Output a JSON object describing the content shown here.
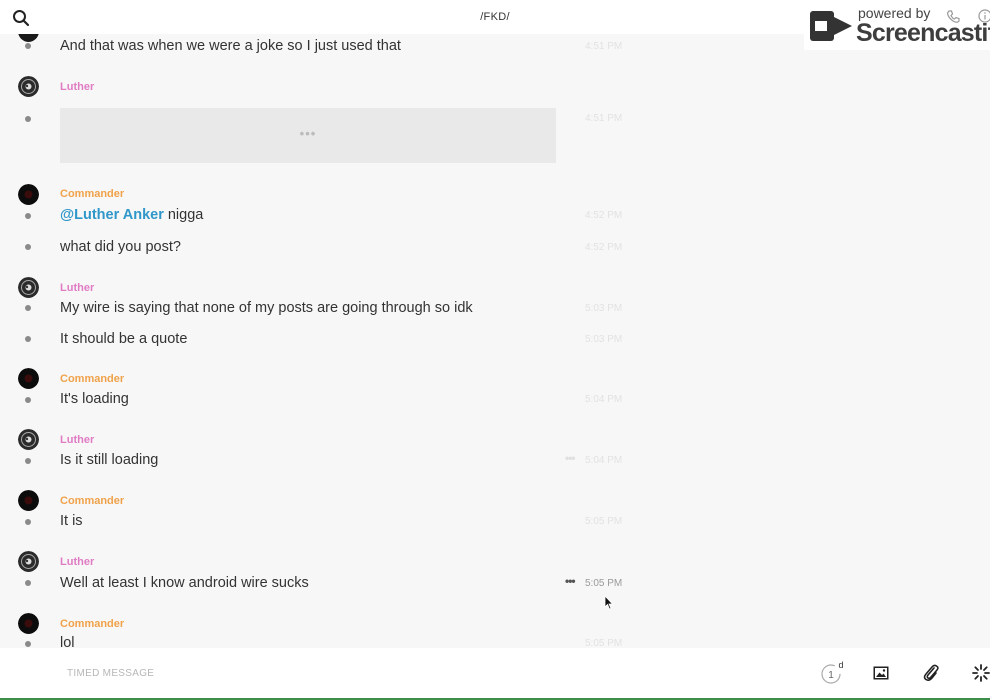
{
  "header": {
    "title": "/FKD/"
  },
  "watermark": {
    "top": "powered by",
    "brand": "Screencastify"
  },
  "messages": [
    {
      "type": "text",
      "text": "And that was when we were a joke so I just used that",
      "time": "4:51 PM"
    },
    {
      "type": "sender",
      "name": "Luther"
    },
    {
      "type": "quote",
      "time": "4:51 PM"
    },
    {
      "type": "sender",
      "name": "Commander"
    },
    {
      "type": "text",
      "mention": "@Luther Anker",
      "text": " nigga",
      "time": "4:52 PM"
    },
    {
      "type": "text",
      "text": "what did you post?",
      "time": "4:52 PM"
    },
    {
      "type": "sender",
      "name": "Luther"
    },
    {
      "type": "text",
      "text": "My wire is saying that none of my posts are going through so idk",
      "time": "5:03 PM"
    },
    {
      "type": "text",
      "text": "It should be a quote",
      "time": "5:03 PM"
    },
    {
      "type": "sender",
      "name": "Commander"
    },
    {
      "type": "text",
      "text": "It's loading",
      "time": "5:04 PM"
    },
    {
      "type": "sender",
      "name": "Luther"
    },
    {
      "type": "text",
      "text": "Is it still loading",
      "time": "5:04 PM"
    },
    {
      "type": "sender",
      "name": "Commander"
    },
    {
      "type": "text",
      "text": "It is",
      "time": "5:05 PM"
    },
    {
      "type": "sender",
      "name": "Luther"
    },
    {
      "type": "text",
      "text": "Well at least I know android wire sucks",
      "time": "5:05 PM"
    },
    {
      "type": "sender",
      "name": "Commander"
    },
    {
      "type": "text",
      "text": "lol",
      "time": "5:05 PM"
    }
  ],
  "footer": {
    "placeholder": "TIMED MESSAGE",
    "timer_value": "1",
    "timer_unit": "d"
  }
}
